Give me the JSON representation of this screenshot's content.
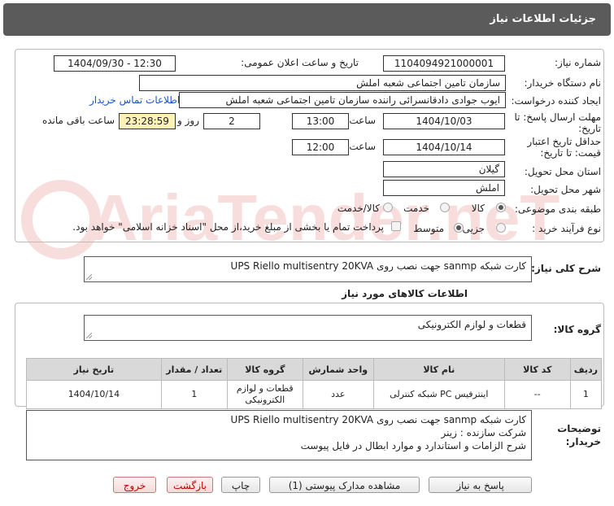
{
  "header": {
    "title": "جزئیات اطلاعات نیاز"
  },
  "form": {
    "need_number": {
      "label": "شماره نیاز:",
      "value": "1104094921000001"
    },
    "announce_datetime": {
      "label": "تاریخ و ساعت اعلان عمومی:",
      "value": "1404/09/30 - 12:30"
    },
    "buyer_org": {
      "label": "نام دستگاه خریدار:",
      "value": "سازمان تامین اجتماعی شعبه املش"
    },
    "requester": {
      "label": "ایجاد کننده درخواست:",
      "value": "ایوب جوادی دادقانسرائی راننده سازمان تامین اجتماعی شعبه املش",
      "contact_link": "اطلاعات تماس خریدار"
    },
    "reply_deadline": {
      "label_line1": "مهلت ارسال پاسخ: تا",
      "label_line2": "تاریخ:",
      "date": "1404/10/03",
      "time_label": "ساعت",
      "time": "13:00",
      "days": "2",
      "days_label": "روز و",
      "remaining": "23:28:59",
      "remaining_label": "ساعت باقی مانده"
    },
    "price_validity": {
      "label_line1": "حداقل تاریخ اعتبار",
      "label_line2": "قیمت: تا تاریخ:",
      "date": "1404/10/14",
      "time_label": "ساعت",
      "time": "12:00"
    },
    "province": {
      "label": "استان محل تحویل:",
      "value": "گیلان"
    },
    "city": {
      "label": "شهر محل تحویل:",
      "value": "املش"
    },
    "category": {
      "label": "طبقه بندی موضوعی:",
      "options": [
        "کالا",
        "خدمت",
        "کالا/خدمت"
      ],
      "selected": "کالا"
    },
    "purchase_type": {
      "label": "نوع فرآیند خرید :",
      "options": [
        "جزیی",
        "متوسط"
      ],
      "selected": "جزیی",
      "payment_note": "پرداخت تمام یا بخشی از مبلغ خرید،از محل \"اسناد خزانه اسلامی\" خواهد بود."
    }
  },
  "summary": {
    "label": "شرح کلی نیاز:",
    "value": "کارت شبکه sanmp جهت نصب روی UPS Riello multisentry 20KVA"
  },
  "goods_info": {
    "title": "اطلاعات کالاهای مورد نیاز",
    "group_label": "گروه کالا:",
    "group_value": "قطعات و لوازم الکترونیکی",
    "table": {
      "headers": [
        "ردیف",
        "کد کالا",
        "نام کالا",
        "واحد شمارش",
        "گروه کالا",
        "تعداد / مقدار",
        "تاریخ نیاز"
      ],
      "rows": [
        [
          "1",
          "--",
          "اینترفیس PC شبکه کنترلی",
          "عدد",
          "قطعات و لوازم الکترونیکی",
          "1",
          "1404/10/14"
        ]
      ]
    }
  },
  "buyer_notes": {
    "label_line1": "توضیحات",
    "label_line2": "خریدار:",
    "lines": [
      "کارت شبکه sanmp جهت نصب روی UPS Riello multisentry 20KVA",
      "شرکت سازنده : زینر",
      "شرح الزامات و استاندارد و موارد ابطال در فایل پیوست"
    ]
  },
  "buttons": {
    "reply": "پاسخ به نیاز",
    "attachments": "مشاهده مدارک پیوستی (1)",
    "print": "چاپ",
    "back": "بازگشت",
    "exit": "خروج"
  },
  "colors": {
    "header_bg": "#5b5b5b",
    "remaining_bg": "#fdf3b6",
    "link": "#1a55c8",
    "exit_text": "#c00000"
  },
  "watermark": {
    "text": "AriaTender.neT"
  }
}
